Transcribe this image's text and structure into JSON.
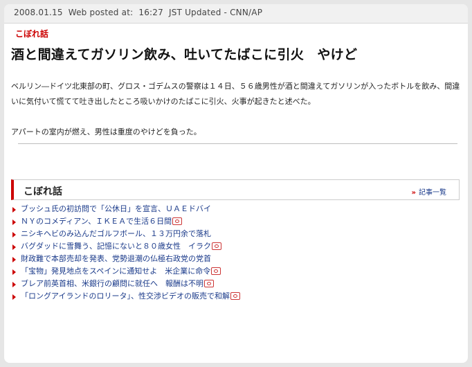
{
  "meta": {
    "date": "2008.01.15",
    "posted_label": "Web posted at:",
    "time": "16:27",
    "updated": "JST Updated - CNN/AP"
  },
  "article": {
    "kicker": "こぼれ話",
    "headline": "酒と間違えてガソリン飲み、吐いてたばこに引火　やけど",
    "paragraphs": [
      "ベルリン―ドイツ北東部の町、グロス・ゴデムスの警察は１４日、５６歳男性が酒と間違えてガソリンが入ったボトルを飲み、間違いに気付いて慌てて吐き出したところ吸いかけのたばこに引火、火事が起きたと述べた。",
      "アパートの室内が燃え、男性は重度のやけどを負った。"
    ]
  },
  "related": {
    "title": "こぼれ話",
    "more_label": "記事一覧",
    "items": [
      {
        "text": "ブッシュ氏の初訪問で「公休日」を宣言、ＵＡＥドバイ",
        "camera": false
      },
      {
        "text": "ＮＹのコメディアン、ＩＫＥＡで生活６日間",
        "camera": true
      },
      {
        "text": "ニシキヘビのみ込んだゴルフボール、１３万円余で落札",
        "camera": false
      },
      {
        "text": "バグダッドに雪舞う、記憶にないと８０歳女性　イラク",
        "camera": true
      },
      {
        "text": "財政難で本部売却を発表、党勢退潮の仏極右政党の党首",
        "camera": false
      },
      {
        "text": "「宝物」発見地点をスペインに通知せよ　米企業に命令",
        "camera": true
      },
      {
        "text": "ブレア前英首相、米銀行の顧問に就任へ　報酬は不明",
        "camera": true
      },
      {
        "text": "「ロングアイランドのロリータ」、性交渉ビデオの販売で和解",
        "camera": true
      }
    ]
  },
  "icons": {
    "camera": "camera-icon",
    "arrow": "double-chevron-right-icon",
    "bullet": "triangle-bullet-icon"
  },
  "colors": {
    "accent": "#cc0000",
    "link": "#1a3a8a"
  }
}
